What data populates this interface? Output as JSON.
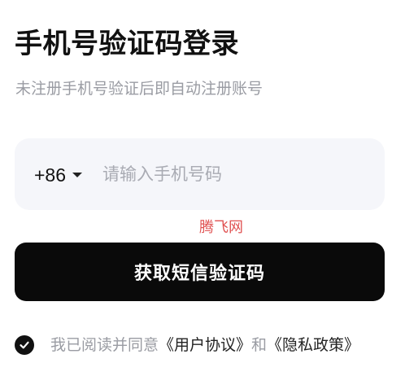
{
  "header": {
    "title": "手机号验证码登录",
    "subtitle": "未注册手机号验证后即自动注册账号"
  },
  "phone": {
    "country_code": "+86",
    "placeholder": "请输入手机号码",
    "value": ""
  },
  "watermark": "腾飞网",
  "actions": {
    "get_code_label": "获取短信验证码"
  },
  "agreement": {
    "checked": true,
    "prefix": "我已阅读并同意",
    "user_agreement": "《用户协议》",
    "joiner": "和",
    "privacy_policy": "《隐私政策》"
  },
  "colors": {
    "primary": "#0a0a0a",
    "input_bg": "#f5f6fa",
    "muted_text": "#9a9ca3",
    "watermark": "#e05252"
  }
}
